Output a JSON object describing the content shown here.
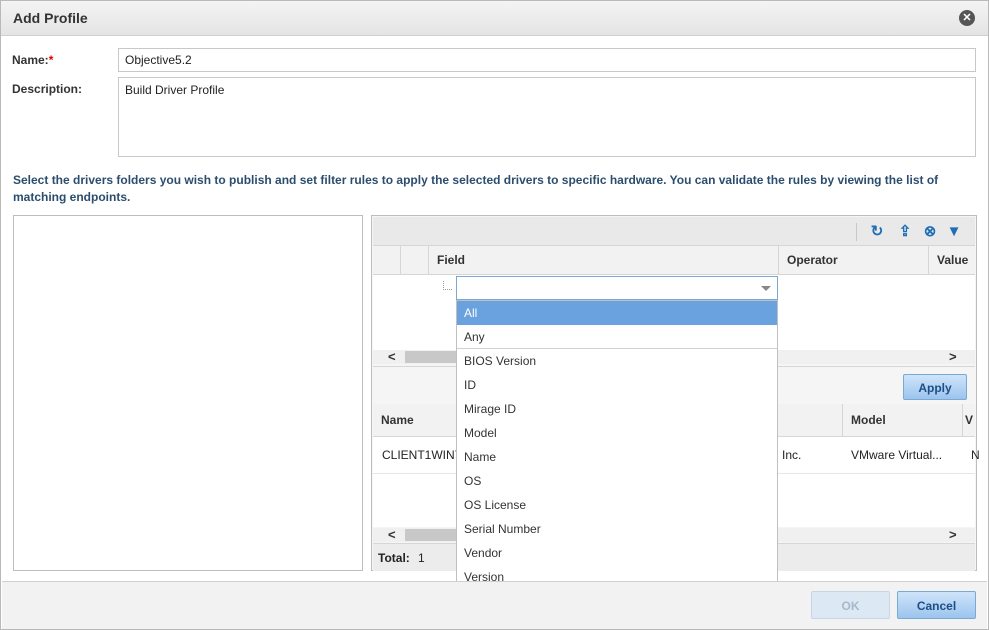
{
  "dialog": {
    "title": "Add Profile"
  },
  "form": {
    "name_label": "Name:",
    "required_mark": "*",
    "name_value": "Objective5.2",
    "description_label": "Description:",
    "description_value": "Build Driver Profile"
  },
  "instructions": "Select the drivers folders you wish to publish and set filter rules to apply the selected drivers to specific hardware. You can validate the rules by viewing the list of matching endpoints.",
  "rules_grid": {
    "columns": [
      "Field",
      "Operator",
      "Value"
    ],
    "toolbar_icons": [
      "refresh-icon",
      "export-icon",
      "clear-filter-icon",
      "filter-icon"
    ]
  },
  "field_dropdown": {
    "value": "",
    "options": [
      "All",
      "Any",
      "BIOS Version",
      "ID",
      "Mirage ID",
      "Model",
      "Name",
      "OS",
      "OS License",
      "Serial Number",
      "Vendor",
      "Version"
    ],
    "selected_index": 0
  },
  "apply_button": "Apply",
  "endpoints_grid": {
    "columns": [
      "Name",
      "Model",
      "V"
    ],
    "rows": [
      {
        "name": "CLIENT1WIN7",
        "vendor_fragment": "Inc.",
        "model": "VMware Virtual...",
        "extra": "N"
      }
    ],
    "total_label": "Total:",
    "total_value": "1"
  },
  "buttons": {
    "ok": "OK",
    "cancel": "Cancel"
  },
  "colors": {
    "accent": "#1e6fb5",
    "selection": "#6aa2e0",
    "instruction_text": "#2b4d6e"
  }
}
